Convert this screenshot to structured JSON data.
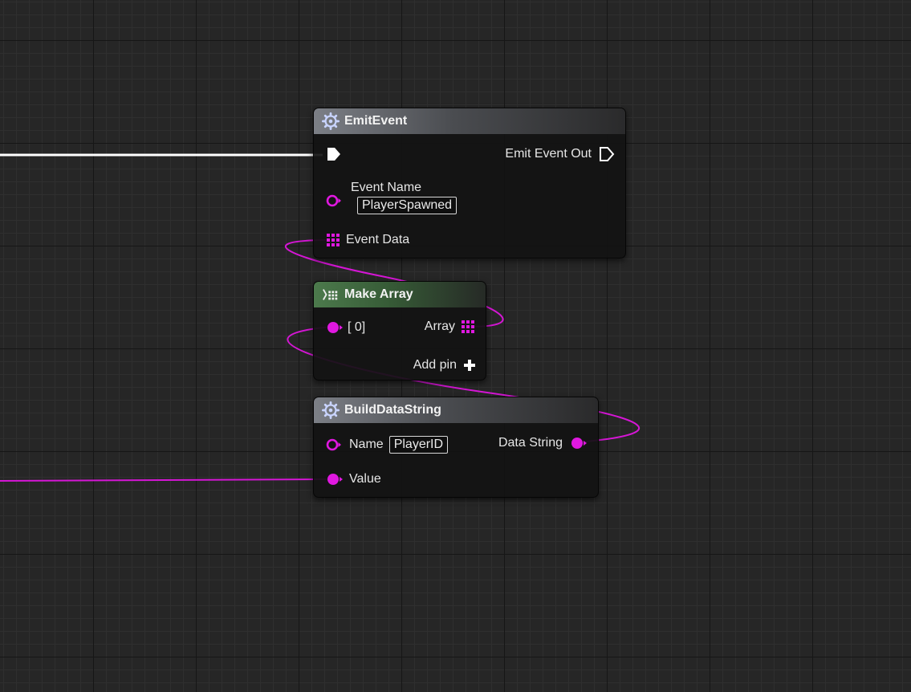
{
  "graph": {
    "pin_color": "#e018e0",
    "exec_color": "#ffffff"
  },
  "nodes": {
    "emit_event": {
      "title": "EmitEvent",
      "icon": "function-gear-icon",
      "exec_out_label": "Emit Event Out",
      "event_name_label": "Event Name",
      "event_name_value": "PlayerSpawned",
      "event_data_label": "Event Data"
    },
    "make_array": {
      "title": "Make Array",
      "icon": "make-array-icon",
      "input0_label": "[ 0]",
      "output_label": "Array",
      "add_pin_label": "Add pin"
    },
    "build_data_string": {
      "title": "BuildDataString",
      "icon": "function-gear-icon",
      "name_label": "Name",
      "name_value": "PlayerID",
      "value_label": "Value",
      "output_label": "Data String"
    }
  }
}
